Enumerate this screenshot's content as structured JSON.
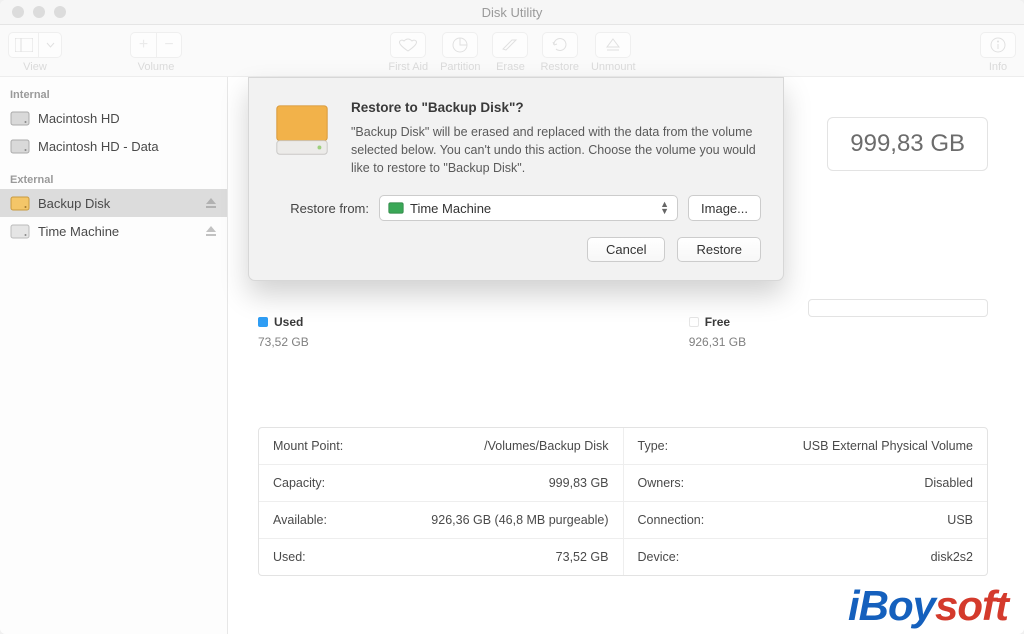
{
  "window": {
    "title": "Disk Utility"
  },
  "toolbar": {
    "view": "View",
    "volume": "Volume",
    "firstaid": "First Aid",
    "partition": "Partition",
    "erase": "Erase",
    "restore": "Restore",
    "unmount": "Unmount",
    "info": "Info"
  },
  "sidebar": {
    "internal_hdr": "Internal",
    "external_hdr": "External",
    "items": [
      {
        "label": "Macintosh HD"
      },
      {
        "label": "Macintosh HD - Data"
      },
      {
        "label": "Backup Disk"
      },
      {
        "label": "Time Machine"
      }
    ]
  },
  "capacity_badge": "999,83 GB",
  "usage": {
    "used_lbl": "Used",
    "used_val": "73,52 GB",
    "free_lbl": "Free",
    "free_val": "926,31 GB"
  },
  "info_left": [
    {
      "k": "Mount Point:",
      "v": "/Volumes/Backup Disk"
    },
    {
      "k": "Capacity:",
      "v": "999,83 GB"
    },
    {
      "k": "Available:",
      "v": "926,36 GB (46,8 MB purgeable)"
    },
    {
      "k": "Used:",
      "v": "73,52 GB"
    }
  ],
  "info_right": [
    {
      "k": "Type:",
      "v": "USB External Physical Volume"
    },
    {
      "k": "Owners:",
      "v": "Disabled"
    },
    {
      "k": "Connection:",
      "v": "USB"
    },
    {
      "k": "Device:",
      "v": "disk2s2"
    }
  ],
  "dialog": {
    "title": "Restore to \"Backup Disk\"?",
    "desc": "\"Backup Disk\" will be erased and replaced with the data from the volume selected below. You can't undo this action. Choose the volume you would like to restore to \"Backup Disk\".",
    "restore_from_lbl": "Restore from:",
    "selected": "Time Machine",
    "image_btn": "Image...",
    "cancel": "Cancel",
    "restore": "Restore"
  },
  "watermark": {
    "pre": "iBoy",
    "red": "soft"
  }
}
